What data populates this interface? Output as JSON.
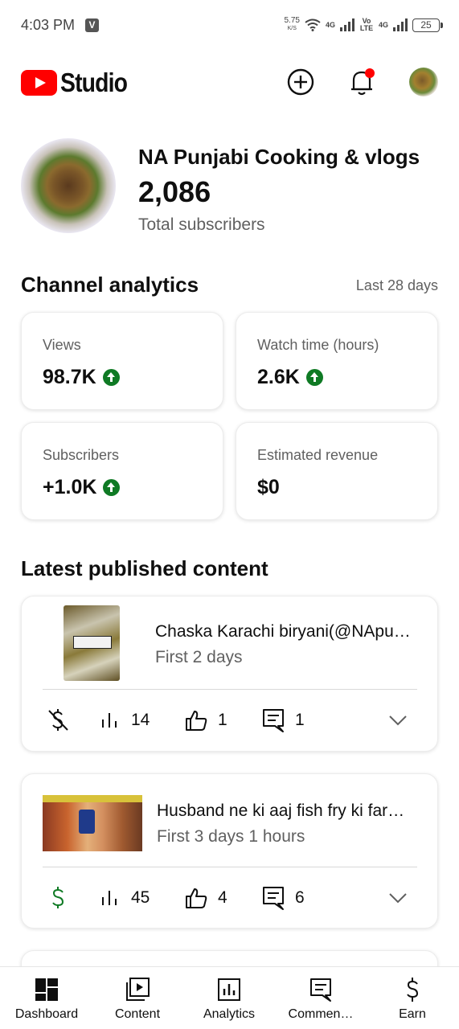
{
  "status_bar": {
    "time": "4:03 PM",
    "net_speed": "5.75",
    "net_unit": "K/S",
    "net_tag_1": "4G",
    "volte": "Vo LTE",
    "net_tag_2": "4G",
    "battery": "25"
  },
  "header": {
    "logo_text": "Studio",
    "brand_color": "#ff0000",
    "icons": [
      "create-icon",
      "notifications-icon",
      "account-avatar"
    ],
    "notification_dot_color": "#ff0000"
  },
  "channel": {
    "name": "NA Punjabi Cooking & vlogs",
    "subscribers": "2,086",
    "subscribers_label": "Total subscribers"
  },
  "analytics": {
    "title": "Channel analytics",
    "period": "Last 28 days",
    "trend_color": "#0f7a24",
    "cards": [
      {
        "label": "Views",
        "value": "98.7K",
        "trend": "up"
      },
      {
        "label": "Watch time (hours)",
        "value": "2.6K",
        "trend": "up"
      },
      {
        "label": "Subscribers",
        "value": "+1.0K",
        "trend": "up"
      },
      {
        "label": "Estimated revenue",
        "value": "$0",
        "trend": "none"
      }
    ]
  },
  "latest": {
    "title": "Latest published content",
    "videos": [
      {
        "title": "Chaska Karachi biryani(@NApu…",
        "subtitle": "First 2 days",
        "monetization": "not-monetized",
        "views": "14",
        "likes": "1",
        "comments": "1"
      },
      {
        "title": "Husband ne ki aaj fish fry ki far…",
        "subtitle": "First 3 days 1 hours",
        "monetization": "monetized",
        "monetized_color": "#0f7a24",
        "views": "45",
        "likes": "4",
        "comments": "6"
      }
    ]
  },
  "bottom_nav": {
    "items": [
      {
        "label": "Dashboard",
        "icon": "dashboard-icon",
        "active": true
      },
      {
        "label": "Content",
        "icon": "content-icon"
      },
      {
        "label": "Analytics",
        "icon": "analytics-icon"
      },
      {
        "label": "Commen…",
        "icon": "comments-icon"
      },
      {
        "label": "Earn",
        "icon": "earn-icon"
      }
    ]
  }
}
